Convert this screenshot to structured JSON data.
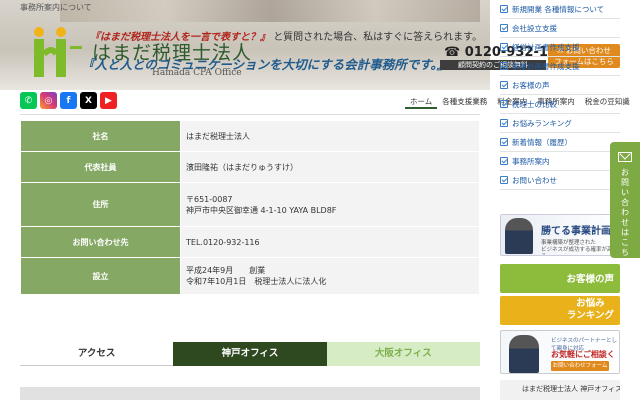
{
  "header": {
    "breadcrumb": "事務所案内について",
    "logo_name": "はまだ税理士法人",
    "logo_en": "Hamada CPA Office",
    "question_hl": "『はまだ税理士法人を一言で表すと？』",
    "question_rest": "と質問された場合、私はすぐに答えられます。",
    "slogan": "『人と人とのコミュニケーションを大切にする会計事務所です。』",
    "tel": "0120-932-116",
    "tel_sub": "顧問契約のご相談無料",
    "contact_btn_line1": "お問い合わせ",
    "contact_btn_line2": "フォームはこちら"
  },
  "social": [
    "LINE",
    "Instagram",
    "f",
    "X",
    "YouTube"
  ],
  "nav": {
    "items": [
      "ホーム",
      "各種支援業務",
      "料金案内",
      "事務所案内",
      "税金の豆知識"
    ]
  },
  "company_table": {
    "rows": [
      {
        "label": "社名",
        "value": "はまだ税理士法人"
      },
      {
        "label": "代表社員",
        "value": "濱田隆祐（はまだりゅうすけ）"
      },
      {
        "label": "住所",
        "value": "〒651-0087",
        "value2": "神戸市中央区御幸通 4-1-10 YAYA BLD8F"
      },
      {
        "label": "お問い合わせ先",
        "value": "TEL.0120-932-116"
      },
      {
        "label": "設立",
        "value": "平成24年9月　　創業",
        "value2": "令和7年10月1日　税理士法人に法人化"
      }
    ]
  },
  "tabs": [
    "アクセス",
    "神戸オフィス",
    "大阪オフィス"
  ],
  "sidebar": {
    "items": [
      "新規開業 各種情報について",
      "会社設立支援",
      "経営計画書作成支援",
      "事業計画書作成支援",
      "お客様の声",
      "税理士の比較",
      "お悩みランキング",
      "新着情報（履歴）",
      "事務所案内",
      "お問い合わせ"
    ],
    "banners": {
      "b1_title": "勝てる事業計画",
      "b1_sub1": "事業構築が整理された",
      "b1_sub2": "ビジネスが成功する確率が高まる",
      "b2": "お客様の声",
      "b3_line1": "お悩み",
      "b3_line2": "ランキング",
      "b4_line1": "ビジネスのパートナーとして親身に対応",
      "b4_line2": "お気軽にご相談ください！",
      "b4_btn": "お問い合わせフォームはこちら",
      "b5": "はまだ税理士法人 神戸オフィス"
    },
    "float_tab": "お問い合わせはこちら"
  }
}
